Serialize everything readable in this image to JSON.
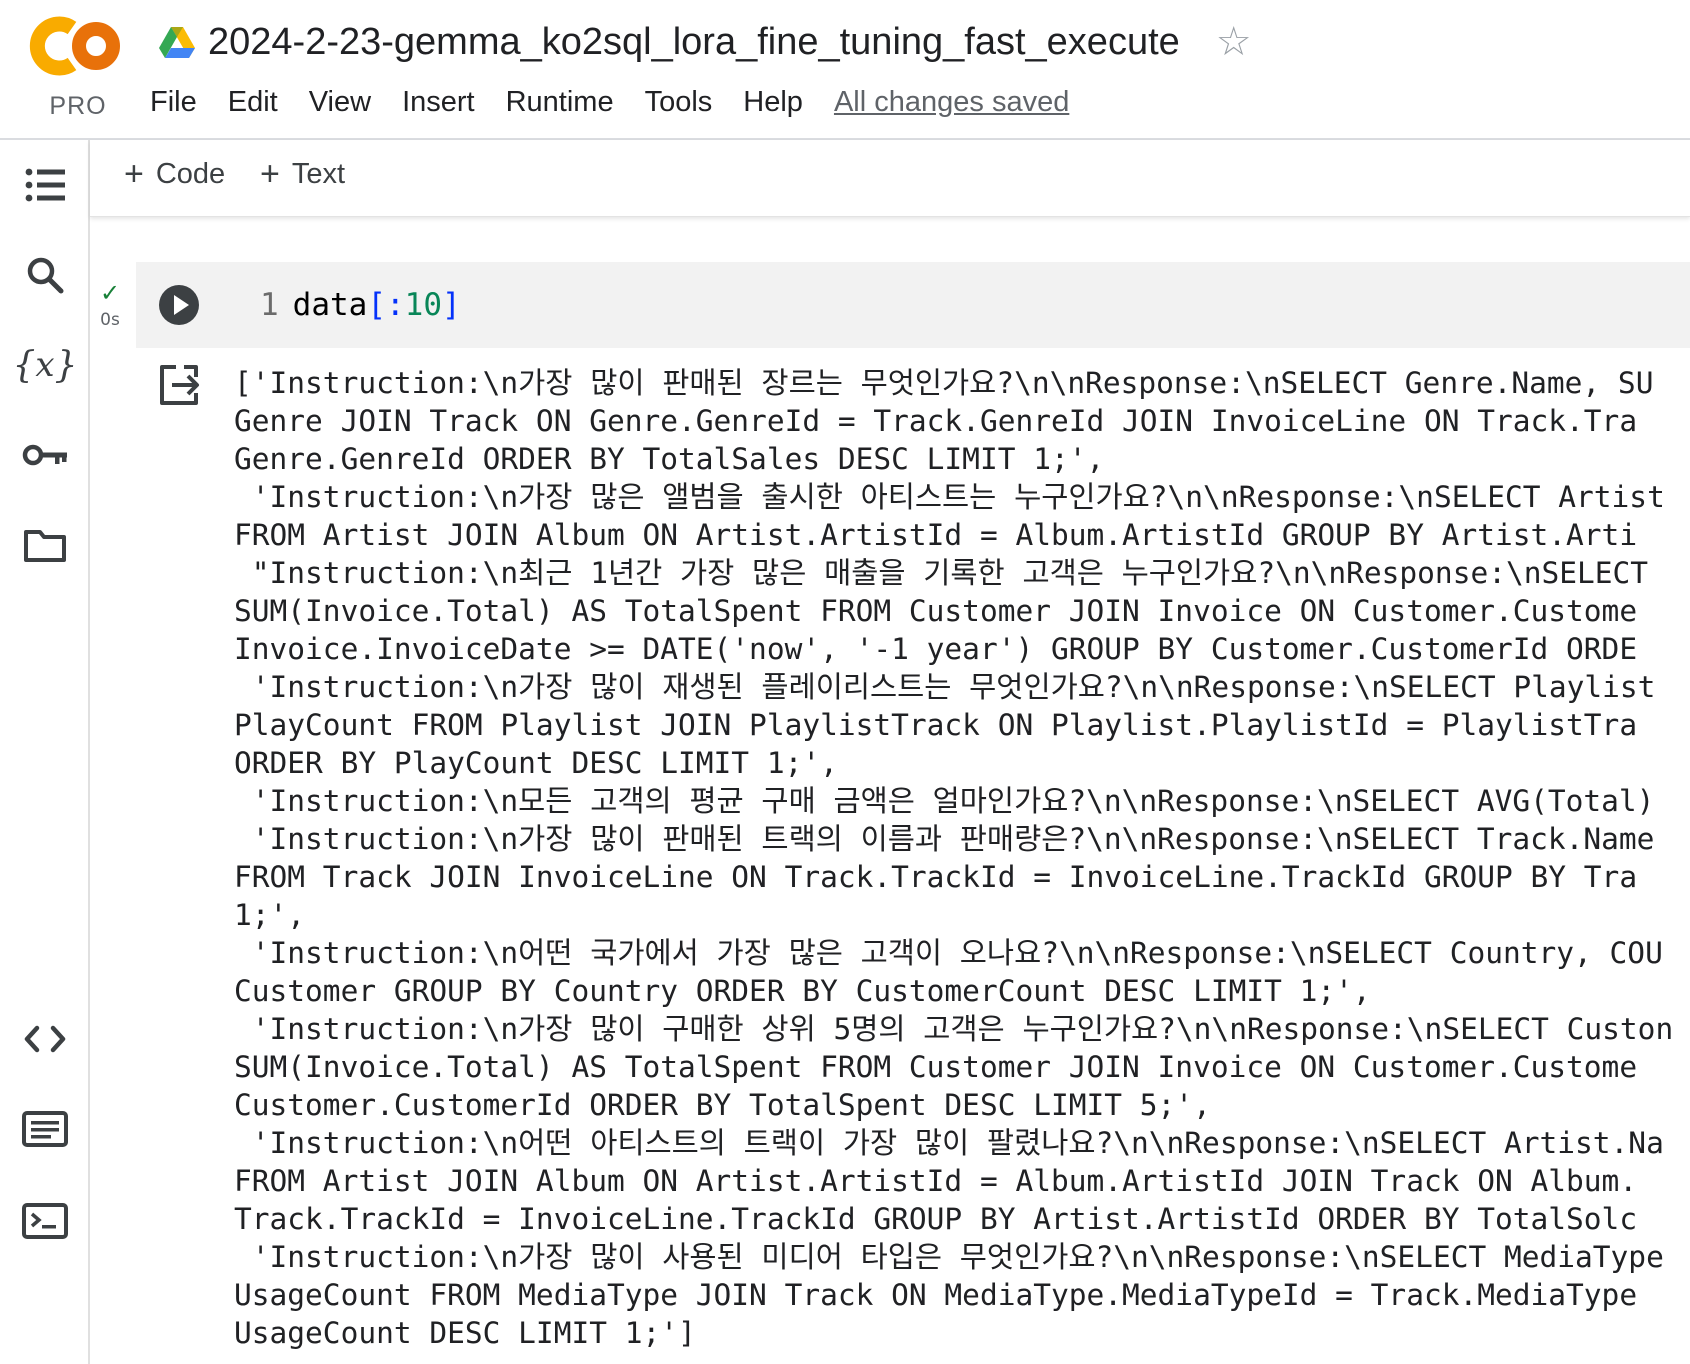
{
  "app": {
    "logo_text": "PRO",
    "title": "2024-2-23-gemma_ko2sql_lora_fine_tuning_fast_execute",
    "save_status": "All changes saved"
  },
  "menu": [
    "File",
    "Edit",
    "View",
    "Insert",
    "Runtime",
    "Tools",
    "Help"
  ],
  "toolbar": {
    "code_label": "Code",
    "text_label": "Text"
  },
  "rail_icons": [
    "table-of-contents-icon",
    "search-icon",
    "variables-icon",
    "secrets-key-icon",
    "files-folder-icon",
    "code-snippets-icon",
    "command-palette-icon",
    "terminal-icon"
  ],
  "cell": {
    "status_check": "✓",
    "exec_time": "0s",
    "line_number": "1",
    "code_ident": "data",
    "code_open": "[:",
    "code_num": "10",
    "code_close": "]"
  },
  "output_lines": [
    "['Instruction:\\n가장 많이 판매된 장르는 무엇인가요?\\n\\nResponse:\\nSELECT Genre.Name, SU",
    "Genre JOIN Track ON Genre.GenreId = Track.GenreId JOIN InvoiceLine ON Track.Tra",
    "Genre.GenreId ORDER BY TotalSales DESC LIMIT 1;',",
    " 'Instruction:\\n가장 많은 앨범을 출시한 아티스트는 누구인가요?\\n\\nResponse:\\nSELECT Artist",
    "FROM Artist JOIN Album ON Artist.ArtistId = Album.ArtistId GROUP BY Artist.Arti",
    " \"Instruction:\\n최근 1년간 가장 많은 매출을 기록한 고객은 누구인가요?\\n\\nResponse:\\nSELECT",
    "SUM(Invoice.Total) AS TotalSpent FROM Customer JOIN Invoice ON Customer.Custome",
    "Invoice.InvoiceDate >= DATE('now', '-1 year') GROUP BY Customer.CustomerId ORDE",
    " 'Instruction:\\n가장 많이 재생된 플레이리스트는 무엇인가요?\\n\\nResponse:\\nSELECT Playlist",
    "PlayCount FROM Playlist JOIN PlaylistTrack ON Playlist.PlaylistId = PlaylistTra",
    "ORDER BY PlayCount DESC LIMIT 1;',",
    " 'Instruction:\\n모든 고객의 평균 구매 금액은 얼마인가요?\\n\\nResponse:\\nSELECT AVG(Total)",
    " 'Instruction:\\n가장 많이 판매된 트랙의 이름과 판매량은?\\n\\nResponse:\\nSELECT Track.Name",
    "FROM Track JOIN InvoiceLine ON Track.TrackId = InvoiceLine.TrackId GROUP BY Tra",
    "1;',",
    " 'Instruction:\\n어떤 국가에서 가장 많은 고객이 오나요?\\n\\nResponse:\\nSELECT Country, COU",
    "Customer GROUP BY Country ORDER BY CustomerCount DESC LIMIT 1;',",
    " 'Instruction:\\n가장 많이 구매한 상위 5명의 고객은 누구인가요?\\n\\nResponse:\\nSELECT Custon",
    "SUM(Invoice.Total) AS TotalSpent FROM Customer JOIN Invoice ON Customer.Custome",
    "Customer.CustomerId ORDER BY TotalSpent DESC LIMIT 5;',",
    " 'Instruction:\\n어떤 아티스트의 트랙이 가장 많이 팔렸나요?\\n\\nResponse:\\nSELECT Artist.Na",
    "FROM Artist JOIN Album ON Artist.ArtistId = Album.ArtistId JOIN Track ON Album.",
    "Track.TrackId = InvoiceLine.TrackId GROUP BY Artist.ArtistId ORDER BY TotalSolc",
    " 'Instruction:\\n가장 많이 사용된 미디어 타입은 무엇인가요?\\n\\nResponse:\\nSELECT MediaType",
    "UsageCount FROM MediaType JOIN Track ON MediaType.MediaTypeId = Track.MediaType",
    "UsageCount DESC LIMIT 1;']"
  ]
}
